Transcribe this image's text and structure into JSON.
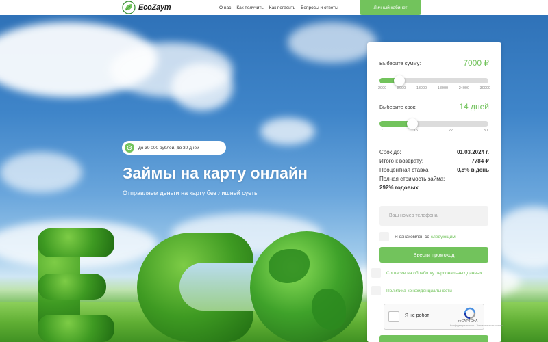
{
  "header": {
    "logo_text": "EcoZaym",
    "nav": [
      "О нас",
      "Как получить",
      "Как погасить",
      "Вопросы и ответы"
    ],
    "cabinet_label": "Личный кабинет"
  },
  "hero": {
    "badge_text": "до 30 000 рублей, до 30 дней",
    "title": "Займы на карту онлайн",
    "subtitle": "Отправляем деньги на карту без лишней суеты"
  },
  "calculator": {
    "amount_label": "Выберите сумму:",
    "amount_value": "7000 ₽",
    "amount_fraction": 0.18,
    "amount_ticks": [
      "2000",
      "8000",
      "13000",
      "18000",
      "24000",
      "30000"
    ],
    "term_label": "Выберите срок:",
    "term_value": "14 дней",
    "term_fraction": 0.3,
    "term_ticks": [
      "7",
      "15",
      "22",
      "30"
    ],
    "summary": [
      {
        "label": "Срок до:",
        "value": "01.03.2024 г."
      },
      {
        "label": "Итого к возврату:",
        "value": "7784 ₽"
      },
      {
        "label": "Процентная ставка:",
        "value": "0,8% в день"
      }
    ],
    "full_cost_label": "Полная стоимость займа:",
    "full_cost_value": "292% годовых",
    "phone_placeholder": "Ваш номер телефона",
    "agree_text": "Я ознакомлен со ",
    "agree_link": "следующим",
    "promo_button": "Ввести промокод",
    "consent_personal": "Согласие на обработку персональных данных",
    "privacy_policy": "Политика конфиденциальности",
    "recaptcha_label": "Я не робот",
    "recaptcha_brand": "reCAPTCHA",
    "recaptcha_terms": "Конфиденциальность - Условия использования"
  },
  "colors": {
    "accent": "#72c35c",
    "header_bg": "#ffffff",
    "card_bg": "#ffffff"
  }
}
